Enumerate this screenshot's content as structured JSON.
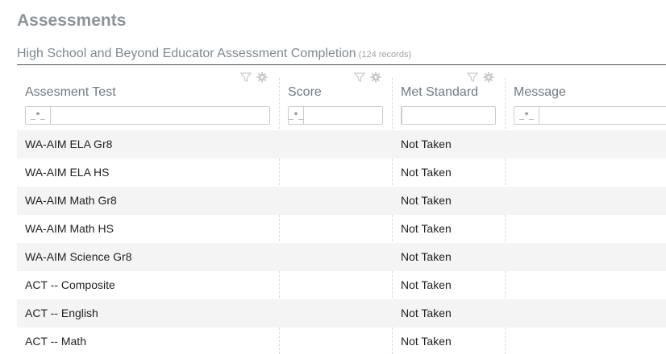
{
  "page": {
    "title": "Assessments"
  },
  "section": {
    "title": "High School and Beyond Educator Assessment Completion",
    "record_count": "(124 records)"
  },
  "columns": [
    {
      "label": "Assesment Test",
      "filter_mode": "*",
      "filter_value": ""
    },
    {
      "label": "Score",
      "filter_mode": "*",
      "filter_value": ""
    },
    {
      "label": "Met Standard",
      "filter_mode": "",
      "filter_value": ""
    },
    {
      "label": "Message",
      "filter_mode": "*",
      "filter_value": ""
    }
  ],
  "icons": {
    "filter": "filter-icon",
    "settings": "gear-icon"
  },
  "colors": {
    "stripe": "#f4f4f4",
    "muted_text": "#8a9599"
  },
  "rows": [
    {
      "test": "WA-AIM ELA Gr8",
      "score": "",
      "met": "Not Taken",
      "message": ""
    },
    {
      "test": "WA-AIM ELA HS",
      "score": "",
      "met": "Not Taken",
      "message": ""
    },
    {
      "test": "WA-AIM Math Gr8",
      "score": "",
      "met": "Not Taken",
      "message": ""
    },
    {
      "test": "WA-AIM Math HS",
      "score": "",
      "met": "Not Taken",
      "message": ""
    },
    {
      "test": "WA-AIM Science Gr8",
      "score": "",
      "met": "Not Taken",
      "message": ""
    },
    {
      "test": "ACT -- Composite",
      "score": "",
      "met": "Not Taken",
      "message": ""
    },
    {
      "test": "ACT -- English",
      "score": "",
      "met": "Not Taken",
      "message": ""
    },
    {
      "test": "ACT -- Math",
      "score": "",
      "met": "Not Taken",
      "message": ""
    }
  ]
}
